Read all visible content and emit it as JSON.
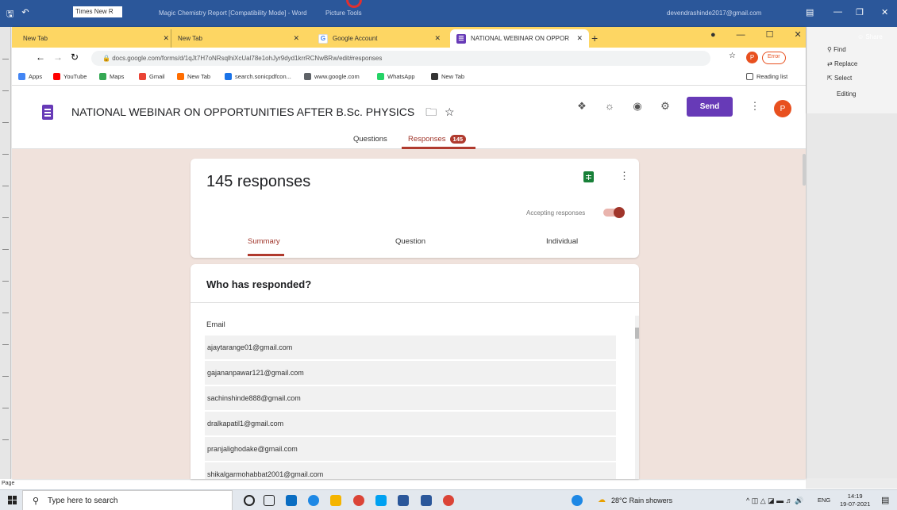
{
  "word": {
    "font_name": "Times New R",
    "title": "Magic Chemistry Report [Compatibility Mode] - Word",
    "picture_tools": "Picture Tools",
    "account": "devendrashinde2017@gmail.com",
    "share_label": "Share",
    "find_label": "Find",
    "replace_label": "Replace",
    "select_label": "Select",
    "editing_label": "Editing",
    "page_label": "Page"
  },
  "chrome": {
    "tabs": [
      {
        "label": "New Tab"
      },
      {
        "label": "New Tab"
      },
      {
        "label": "Google Account"
      },
      {
        "label": "NATIONAL WEBINAR ON OPPOR"
      }
    ],
    "url": "docs.google.com/forms/d/1qJt7H7oNRsqlhiXcUal78e1ohJyr9dyd1krrRCNwBRw/edit#responses",
    "error_label": "Error",
    "bookmarks": [
      {
        "label": "Apps",
        "color": "#4285f4"
      },
      {
        "label": "YouTube",
        "color": "#ff0000"
      },
      {
        "label": "Maps",
        "color": "#34a853"
      },
      {
        "label": "Gmail",
        "color": "#ea4335"
      },
      {
        "label": "New Tab",
        "color": "#ff6d00"
      },
      {
        "label": "search.sonicpdfcon...",
        "color": "#1a73e8"
      },
      {
        "label": "www.google.com",
        "color": "#5f6368"
      },
      {
        "label": "WhatsApp",
        "color": "#25d366"
      },
      {
        "label": "New Tab",
        "color": "#333333"
      }
    ],
    "reading_list": "Reading list"
  },
  "form": {
    "title": "NATIONAL WEBINAR ON OPPORTUNITIES AFTER B.Sc. PHYSICS",
    "send_label": "Send",
    "avatar_letter": "P",
    "tab_questions": "Questions",
    "tab_responses": "Responses",
    "responses_count": "145",
    "responses_heading": "145 responses",
    "accepting_label": "Accepting responses",
    "accepting_responses": true,
    "subtabs": [
      "Summary",
      "Question",
      "Individual"
    ],
    "who_heading": "Who has responded?",
    "email_label": "Email",
    "emails": [
      "ajaytarange01@gmail.com",
      "gajananpawar121@gmail.com",
      "sachinshinde888@gmail.com",
      "dralkapatil1@gmail.com",
      "pranjalighodake@gmail.com",
      "shikalgarmohabbat2001@gmail.com"
    ],
    "accent_color": "#673ab7",
    "response_accent": "#a0352a"
  },
  "taskbar": {
    "search_placeholder": "Type here to search",
    "weather": "28°C  Rain showers",
    "lang": "ENG",
    "time": "14:19",
    "date": "19-07-2021"
  }
}
